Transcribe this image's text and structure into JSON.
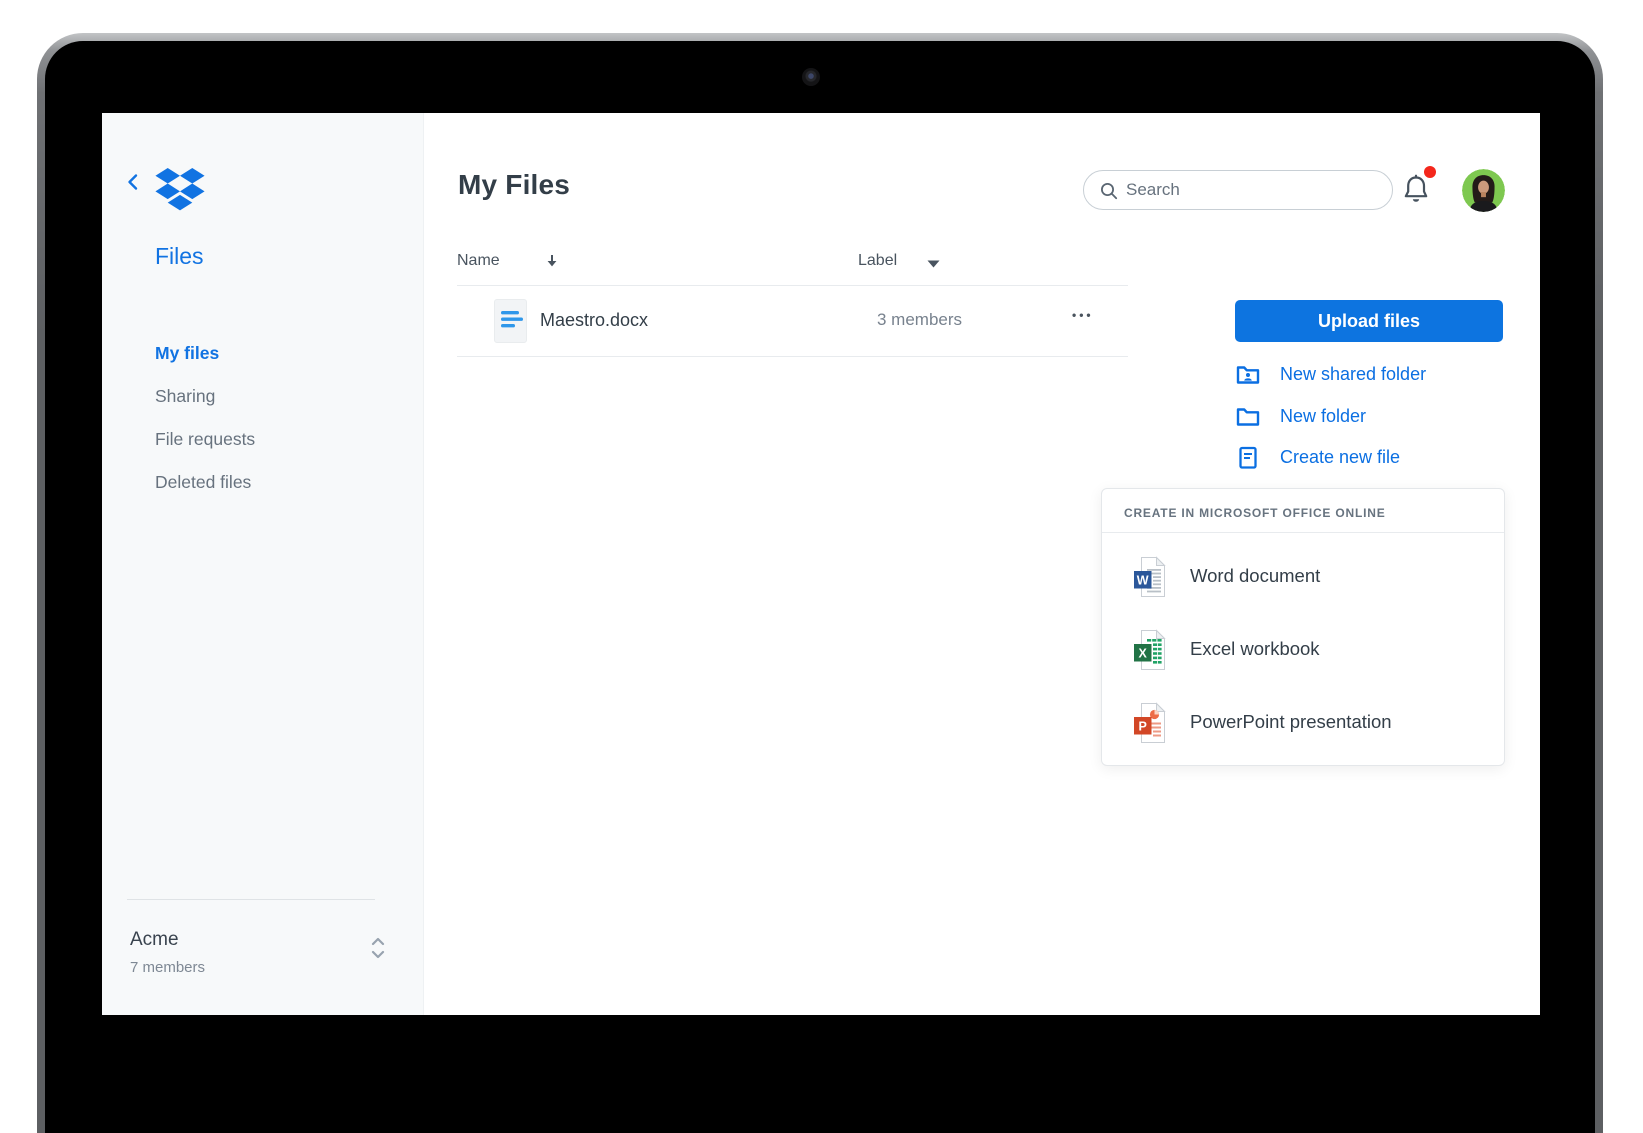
{
  "colors": {
    "accent_blue": "#1173e2",
    "button_blue": "#0d74e0",
    "link_blue": "#0b6fe2",
    "notification_red": "#f4271c",
    "avatar_green": "#7ec850",
    "word_blue": "#2b579a",
    "excel_green": "#217346",
    "powerpoint_orange": "#d24726"
  },
  "sidebar": {
    "back_icon": "chevron-left-icon",
    "logo_icon": "dropbox-logo",
    "section_title": "Files",
    "items": [
      {
        "label": "My files",
        "active": true
      },
      {
        "label": "Sharing",
        "active": false
      },
      {
        "label": "File requests",
        "active": false
      },
      {
        "label": "Deleted files",
        "active": false
      }
    ],
    "team": {
      "name": "Acme",
      "members": "7 members",
      "toggle_icon": "up-down-chevrons-icon"
    }
  },
  "header": {
    "title": "My Files",
    "search_icon": "search-icon",
    "search_placeholder": "Search",
    "bell_icon": "bell-icon",
    "notification_dot": true,
    "avatar_icon": "user-avatar"
  },
  "table": {
    "name_header": "Name",
    "name_sort_icon": "sort-descending-icon",
    "label_header": "Label",
    "label_caret_icon": "caret-down-icon",
    "rows": [
      {
        "icon": "document-icon",
        "name": "Maestro.docx",
        "label": "3 members",
        "more": "•••"
      }
    ]
  },
  "actions": {
    "upload_label": "Upload files",
    "links": [
      {
        "icon": "shared-folder-icon",
        "label": "New shared folder"
      },
      {
        "icon": "folder-icon",
        "label": "New folder"
      },
      {
        "icon": "new-file-icon",
        "label": "Create new file"
      }
    ]
  },
  "office_menu": {
    "header": "CREATE IN MICROSOFT OFFICE ONLINE",
    "items": [
      {
        "icon": "word-icon",
        "label": "Word document"
      },
      {
        "icon": "excel-icon",
        "label": "Excel workbook"
      },
      {
        "icon": "powerpoint-icon",
        "label": "PowerPoint presentation"
      }
    ]
  }
}
